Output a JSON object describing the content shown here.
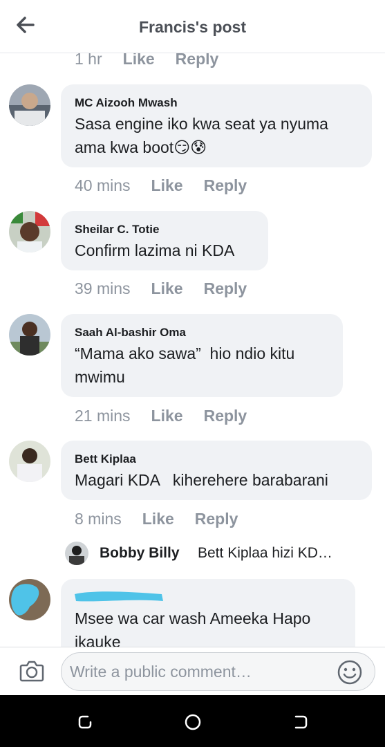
{
  "header": {
    "title": "Francis's post"
  },
  "top_meta": {
    "time": "1 hr",
    "like": "Like",
    "reply": "Reply"
  },
  "comments": [
    {
      "name": "MC Aizooh Mwash",
      "text": "Sasa engine iko kwa seat ya nyuma\nama kwa boot😏😰",
      "time": "40 mins",
      "like": "Like",
      "reply": "Reply"
    },
    {
      "name": "Sheilar C. Totie",
      "text": "Confirm lazima ni KDA",
      "time": "39 mins",
      "like": "Like",
      "reply": "Reply"
    },
    {
      "name": "Saah Al-bashir Oma",
      "text": "“Mama ako sawa”  hio ndio kitu\nmwimu",
      "time": "21 mins",
      "like": "Like",
      "reply": "Reply"
    },
    {
      "name": "Bett Kiplaa",
      "text": "Magari KDA   kiherehere barabarani",
      "time": "8 mins",
      "like": "Like",
      "reply": "Reply"
    },
    {
      "name": "",
      "text": "Msee wa car wash Ameeka Hapo\nikauke"
    }
  ],
  "reply_preview": {
    "name": "Bobby Billy",
    "text": "Bett Kiplaa hizi KD…"
  },
  "composer": {
    "placeholder": "Write a public comment…"
  },
  "icons": [
    "back-arrow-icon",
    "camera-icon",
    "smiley-icon",
    "recent-apps-icon",
    "home-icon",
    "back-icon"
  ],
  "colors": {
    "bubble": "#f0f2f5",
    "meta": "#8d949e",
    "redaction": "#4fc3e8"
  }
}
